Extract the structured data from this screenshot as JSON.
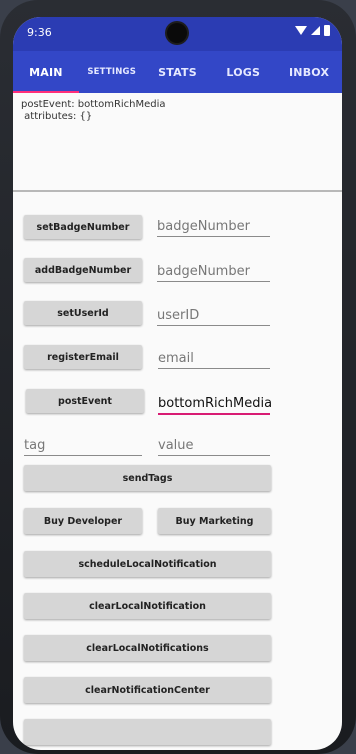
{
  "status": {
    "time": "9:36"
  },
  "tabs": [
    {
      "label": "MAIN",
      "active": true
    },
    {
      "label": "SETTINGS",
      "active": false
    },
    {
      "label": "STATS",
      "active": false
    },
    {
      "label": "LOGS",
      "active": false
    },
    {
      "label": "INBOX",
      "active": false
    }
  ],
  "log": {
    "line1": "postEvent: bottomRichMedia",
    "line2": " attributes: {}"
  },
  "rows": {
    "badge_set": {
      "button": "setBadgeNumber",
      "placeholder": "badgeNumber"
    },
    "badge_add": {
      "button": "addBadgeNumber",
      "placeholder": "badgeNumber"
    },
    "user": {
      "button": "setUserId",
      "placeholder": "userID"
    },
    "email": {
      "button": "registerEmail",
      "placeholder": "email"
    },
    "event": {
      "button": "postEvent",
      "value": "bottomRichMedia"
    },
    "tags": {
      "tag_placeholder": "tag",
      "value_placeholder": "value",
      "button": "sendTags"
    }
  },
  "buttons": {
    "buy_developer": "Buy Developer",
    "buy_marketing": "Buy Marketing",
    "schedule": "scheduleLocalNotification",
    "clear_one": "clearLocalNotification",
    "clear_all": "clearLocalNotifications",
    "clear_center": "clearNotificationCenter"
  },
  "colors": {
    "primary": "#3347c7",
    "accent": "#ff2e7a",
    "status_bar": "#2b3cb3"
  }
}
